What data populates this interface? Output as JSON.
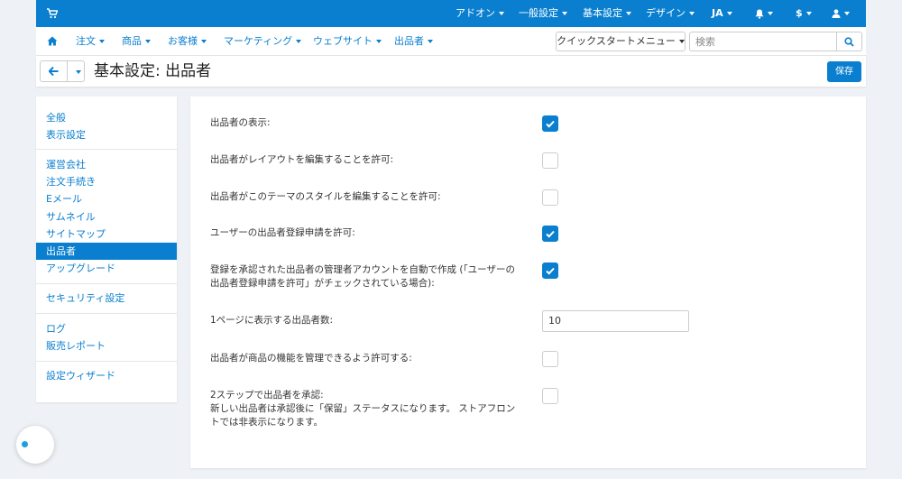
{
  "topbar": {
    "cart_icon": "cart-icon",
    "addons": "アドオン",
    "general_settings": "一般設定",
    "basic_settings": "基本設定",
    "design": "デザイン",
    "language": "JA",
    "notifications_icon": "bell-icon",
    "currency": "$",
    "user_icon": "user-icon"
  },
  "navbar": {
    "home_icon": "home-icon",
    "items": [
      "注文",
      "商品",
      "お客様",
      "マーケティング",
      "ウェブサイト",
      "出品者"
    ],
    "quick_start": "クイックスタートメニュー",
    "search_placeholder": "検索",
    "search_icon": "search-icon"
  },
  "titlebar": {
    "title": "基本設定: 出品者",
    "save": "保存"
  },
  "sidebar": {
    "groups": [
      [
        "全般",
        "表示設定"
      ],
      [
        "運営会社",
        "注文手続き",
        "Eメール",
        "サムネイル",
        "サイトマップ",
        "出品者",
        "アップグレード"
      ],
      [
        "セキュリティ設定"
      ],
      [
        "ログ",
        "販売レポート"
      ],
      [
        "設定ウィザード"
      ]
    ],
    "active": "出品者"
  },
  "settings": [
    {
      "label": "出品者の表示:",
      "checked": true
    },
    {
      "label": "出品者がレイアウトを編集することを許可:",
      "checked": false
    },
    {
      "label": "出品者がこのテーマのスタイルを編集することを許可:",
      "checked": false
    },
    {
      "label": "ユーザーの出品者登録申請を許可:",
      "checked": true
    },
    {
      "label": "登録を承認された出品者の管理者アカウントを自動で作成 (「ユーザーの出品者登録申請を許可」がチェックされている場合):",
      "checked": true
    },
    {
      "label": "1ページに表示する出品者数:",
      "value": "10"
    },
    {
      "label": "出品者が商品の機能を管理できるよう許可する:",
      "checked": false
    },
    {
      "label": "2ステップで出品者を承認:",
      "note": "新しい出品者は承認後に「保留」ステータスになります。 ストアフロントでは非表示になります。",
      "checked": false
    }
  ],
  "colors": {
    "accent": "#0a7fcf",
    "background": "#eef1f5"
  }
}
